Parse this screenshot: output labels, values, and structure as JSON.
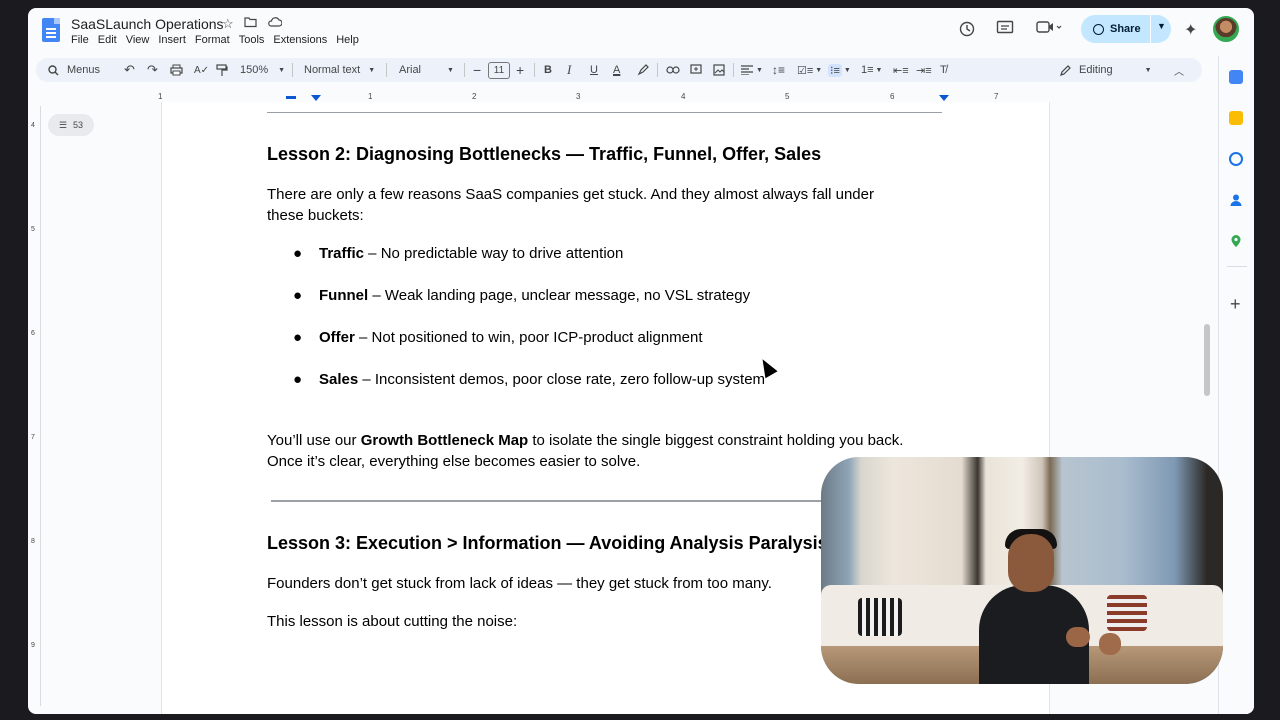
{
  "window": {
    "doc_title": "SaaSLaunch Operations",
    "menu": [
      "File",
      "Edit",
      "View",
      "Insert",
      "Format",
      "Tools",
      "Extensions",
      "Help"
    ],
    "share_label": "Share"
  },
  "toolbar": {
    "menus_label": "Menus",
    "zoom": "150%",
    "style": "Normal text",
    "font": "Arial",
    "font_size": "11",
    "mode": "Editing"
  },
  "ruler": {
    "marks": [
      "1",
      "1",
      "2",
      "3",
      "4",
      "5",
      "6",
      "7"
    ]
  },
  "vruler": {
    "marks": [
      "4",
      "5",
      "6",
      "7",
      "8",
      "9"
    ]
  },
  "outline": {
    "count": "53"
  },
  "document": {
    "lesson2_heading": "Lesson 2: Diagnosing Bottlenecks — Traffic, Funnel, Offer, Sales",
    "lesson2_intro_line1": "There are only a few reasons SaaS companies get stuck. And they almost always fall under",
    "lesson2_intro_line2": "these buckets:",
    "bullets": [
      {
        "term": "Traffic",
        "text": " – No predictable way to drive attention"
      },
      {
        "term": "Funnel",
        "text": " – Weak landing page, unclear message, no VSL strategy"
      },
      {
        "term": "Offer",
        "text": " – Not positioned to win, poor ICP-product alignment"
      },
      {
        "term": "Sales",
        "text": " – Inconsistent demos, poor close rate, zero follow-up system"
      }
    ],
    "map_pre": "You’ll use our ",
    "map_bold": "Growth Bottleneck Map",
    "map_post": " to isolate the single biggest constraint holding you back.",
    "map_line2": " Once it’s clear, everything else becomes easier to solve.",
    "lesson3_heading": "Lesson 3: Execution > Information — Avoiding Analysis Paralysis",
    "lesson3_p1": "Founders don’t get stuck from lack of ideas — they get stuck from too many.",
    "lesson3_p2": "This lesson is about cutting the noise:"
  },
  "colors": {
    "share_bg": "#c2e7ff",
    "toolbar_bg": "#edf2fa",
    "page_bg": "#ffffff",
    "accent": "#0b57d0"
  }
}
